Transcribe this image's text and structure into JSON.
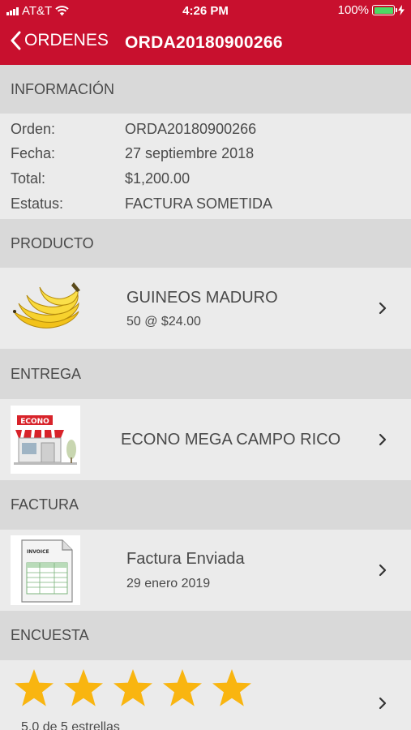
{
  "status": {
    "carrier": "AT&T",
    "time": "4:26 PM",
    "battery": "100%",
    "battery_level": 1.0
  },
  "nav": {
    "back_label": "ORDENES",
    "title": "ORDA20180900266"
  },
  "info": {
    "header": "INFORMACIÓN",
    "rows": [
      {
        "label": "Orden:",
        "value": "ORDA20180900266"
      },
      {
        "label": "Fecha:",
        "value": "27 septiembre 2018"
      },
      {
        "label": "Total:",
        "value": "$1,200.00"
      },
      {
        "label": "Estatus:",
        "value": "FACTURA SOMETIDA"
      }
    ]
  },
  "product": {
    "header": "PRODUCTO",
    "name": "GUINEOS MADURO",
    "detail": "50  @  $24.00"
  },
  "delivery": {
    "header": "ENTREGA",
    "store": "ECONO MEGA CAMPO RICO",
    "logo_text": "ECONO"
  },
  "invoice": {
    "header": "FACTURA",
    "title": "Factura Enviada",
    "date": "29 enero 2019",
    "doc_label": "INVOICE"
  },
  "survey": {
    "header": "ENCUESTA",
    "rating": 5,
    "max": 5,
    "rating_text": "5.0  de  5 estrellas"
  },
  "colors": {
    "brand_red": "#c8102e",
    "star": "#f9b510",
    "section": "#d9d9d9",
    "row_bg": "#ebebeb"
  }
}
